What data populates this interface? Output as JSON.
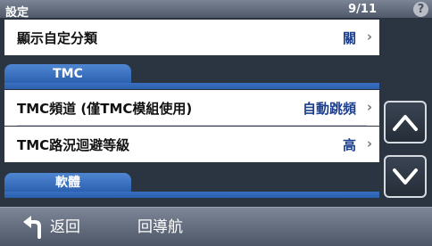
{
  "header": {
    "title": "設定",
    "page_indicator": "9/11",
    "help_glyph": "?"
  },
  "rows": [
    {
      "label": "顯示自定分類",
      "value": "關"
    },
    {
      "label": "TMC頻道 (僅TMC模組使用)",
      "value": "自動跳頻"
    },
    {
      "label": "TMC路況迴避等級",
      "value": "高"
    }
  ],
  "chevron": "›",
  "sections": {
    "tmc": "TMC",
    "software": "軟體"
  },
  "footer": {
    "back_label": "返回",
    "navigate_label": "回導航"
  },
  "colors": {
    "accent_blue": "#2a5fae",
    "value_blue": "#1d3f8c"
  },
  "icons": {
    "scroll_up": "chevron-up-icon",
    "scroll_down": "chevron-down-icon",
    "back": "back-arrow-icon"
  }
}
